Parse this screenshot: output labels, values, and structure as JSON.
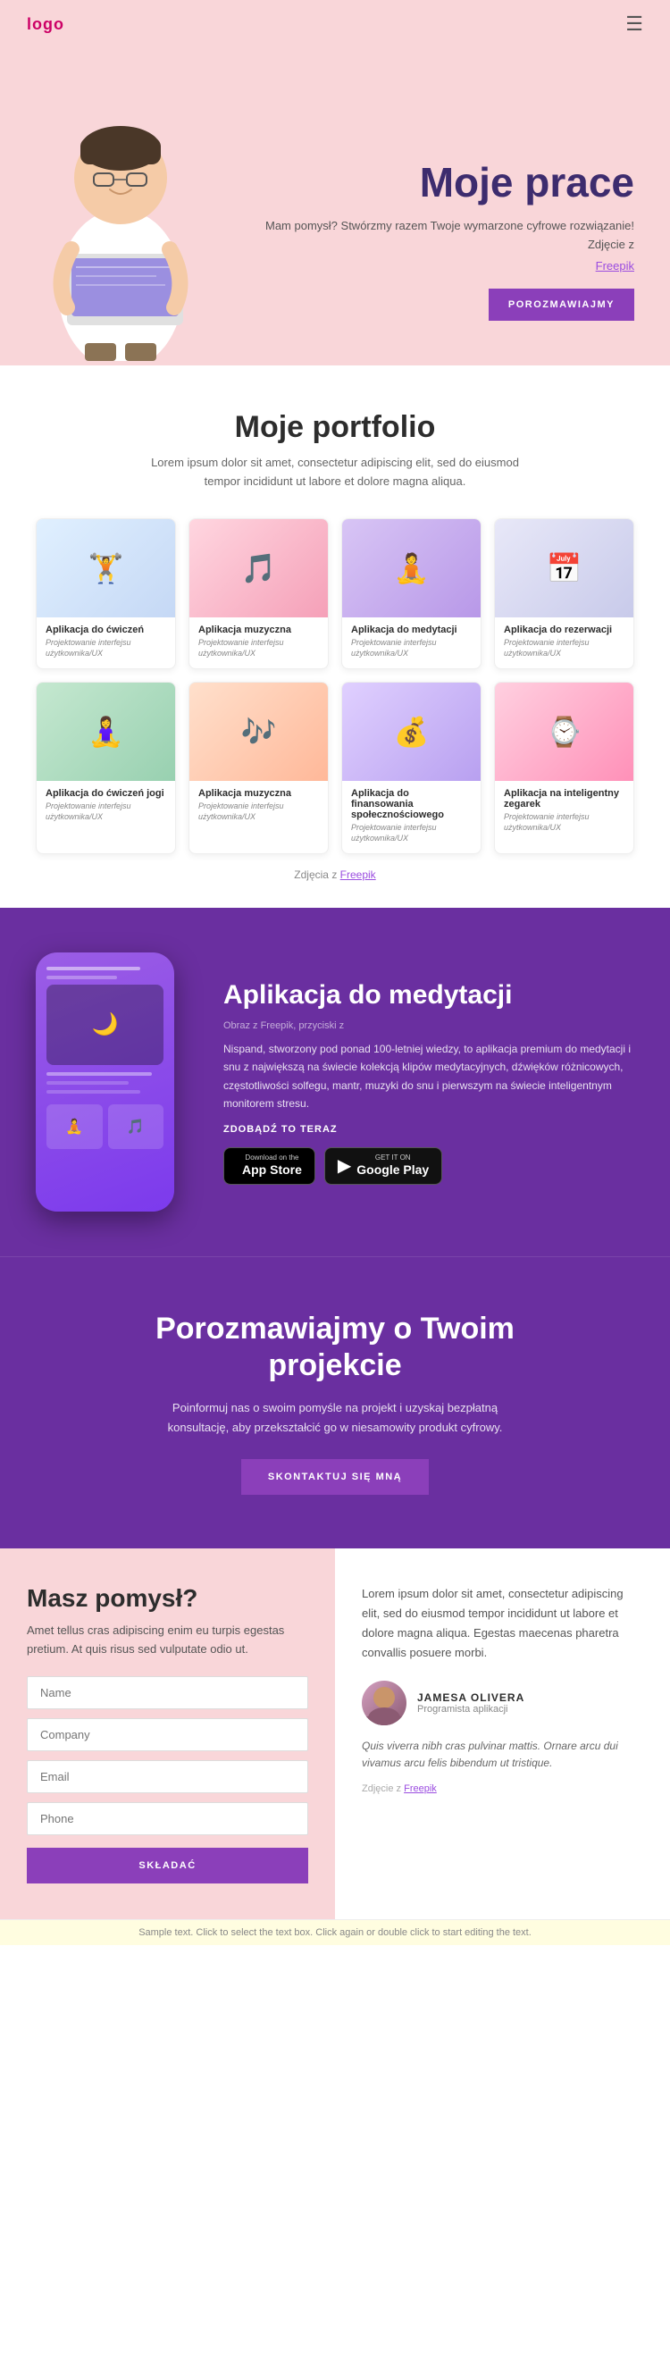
{
  "header": {
    "logo": "logo",
    "menu_icon": "☰"
  },
  "hero": {
    "title": "Moje prace",
    "subtitle": "Mam pomysł? Stwórzmy razem Twoje wymarzone cyfrowe rozwiązanie! Zdjęcie z",
    "photo_credit_link": "Freepik",
    "button_label": "POROZMAWIAJMY"
  },
  "portfolio": {
    "section_title": "Moje portfolio",
    "section_subtitle": "Lorem ipsum dolor sit amet, consectetur adipiscing elit, sed do eiusmod tempor incididunt ut labore et dolore magna aliqua.",
    "cards": [
      {
        "name": "Aplikacja do ćwiczeń",
        "category": "Projektowanie interfejsu użytkownika/UX",
        "icon": "🏋️",
        "color_class": "card-img-1"
      },
      {
        "name": "Aplikacja muzyczna",
        "category": "Projektowanie interfejsu użytkownika/UX",
        "icon": "🎵",
        "color_class": "card-img-2"
      },
      {
        "name": "Aplikacja do medytacji",
        "category": "Projektowanie interfejsu użytkownika/UX",
        "icon": "🧘",
        "color_class": "card-img-3"
      },
      {
        "name": "Aplikacja do rezerwacji",
        "category": "Projektowanie interfejsu użytkownika/UX",
        "icon": "📅",
        "color_class": "card-img-4"
      },
      {
        "name": "Aplikacja do ćwiczeń jogi",
        "category": "Projektowanie interfejsu użytkownika/UX",
        "icon": "🧘‍♀️",
        "color_class": "card-img-5"
      },
      {
        "name": "Aplikacja muzyczna",
        "category": "Projektowanie interfejsu użytkownika/UX",
        "icon": "🎶",
        "color_class": "card-img-6"
      },
      {
        "name": "Aplikacja do finansowania społecznościowego",
        "category": "Projektowanie interfejsu użytkownika/UX",
        "icon": "💰",
        "color_class": "card-img-7"
      },
      {
        "name": "Aplikacja na inteligentny zegarek",
        "category": "Projektowanie interfejsu użytkownika/UX",
        "icon": "⌚",
        "color_class": "card-img-8"
      }
    ],
    "footer_text": "Zdjęcia z",
    "footer_link": "Freepik"
  },
  "meditation": {
    "title": "Aplikacja do medytacji",
    "photo_credit": "Obraz z Freepik, przyciski z",
    "description": "Nispand, stworzony pod ponad 100-letniej wiedzy, to aplikacja premium do medytacji i snu z największą na świecie kolekcją klipów medytacyjnych, dźwięków różnicowych, częstotliwości solfegu, mantr, muzyki do snu i pierwszym na świecie inteligentnym monitorem stresu.",
    "cta_label": "ZDOBĄDŹ TO TERAZ",
    "app_store_sub": "Download on the",
    "app_store_name": "App Store",
    "google_play_sub": "GET IT ON",
    "google_play_name": "Google Play"
  },
  "contact_cta": {
    "title": "Porozmawiajmy o Twoim projekcie",
    "subtitle": "Poinformuj nas o swoim pomyśle na projekt i uzyskaj bezpłatną konsultację, aby przekształcić go w niesamowity produkt cyfrowy.",
    "button_label": "SKONTAKTUJ SIĘ MNĄ"
  },
  "contact_form": {
    "left_title": "Masz pomysł?",
    "left_text": "Amet tellus cras adipiscing enim eu turpis egestas pretium. At quis risus sed vulputate odio ut.",
    "fields": [
      {
        "placeholder": "Name",
        "type": "text"
      },
      {
        "placeholder": "Company",
        "type": "text"
      },
      {
        "placeholder": "Email",
        "type": "email"
      },
      {
        "placeholder": "Phone",
        "type": "tel"
      }
    ],
    "submit_label": "SKŁADAĆ",
    "right_text": "Lorem ipsum dolor sit amet, consectetur adipiscing elit, sed do eiusmod tempor incididunt ut labore et dolore magna aliqua. Egestas maecenas pharetra convallis posuere morbi.",
    "testimonial_name": "JAMESA OLIVERA",
    "testimonial_role": "Programista aplikacji",
    "testimonial_quote": "Quis viverra nibh cras pulvinar mattis. Ornare arcu dui vivamus arcu felis bibendum ut tristique.",
    "footer_text": "Zdjęcie z",
    "footer_link": "Freepik"
  },
  "sample_bar": {
    "text": "Sample text. Click to select the text box. Click again or double click to start editing the text."
  }
}
